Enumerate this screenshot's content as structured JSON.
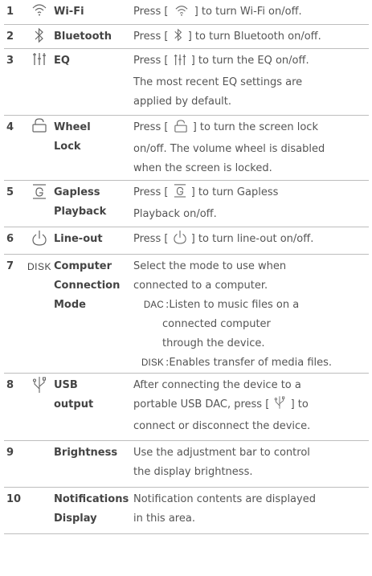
{
  "rows": [
    {
      "num": "1",
      "icon": "wifi-icon",
      "name_lines": [
        "Wi-Fi"
      ],
      "desc_lines": [
        "Press [",
        "] to turn Wi-Fi on/off."
      ]
    },
    {
      "num": "2",
      "icon": "bluetooth-icon",
      "name_lines": [
        "Bluetooth"
      ],
      "desc_lines": [
        "Press [",
        "] to turn Bluetooth on/off."
      ]
    },
    {
      "num": "3",
      "icon": "eq-icon",
      "name_lines": [
        "EQ"
      ],
      "desc_lines": [
        "Press [",
        "] to turn the EQ on/off.",
        "The most recent EQ settings are",
        "applied by default."
      ]
    },
    {
      "num": "4",
      "icon": "lock-icon",
      "name_lines": [
        "Wheel",
        "Lock"
      ],
      "desc_lines": [
        "Press [",
        "] to turn the screen lock",
        "on/off. The volume wheel is disabled",
        "when the screen is locked."
      ]
    },
    {
      "num": "5",
      "icon": "gapless-icon",
      "name_lines": [
        "Gapless",
        "Playback"
      ],
      "desc_lines": [
        "Press [",
        "] to turn Gapless",
        "Playback on/off."
      ]
    },
    {
      "num": "6",
      "icon": "power-icon",
      "name_lines": [
        "Line-out"
      ],
      "desc_lines": [
        "Press [",
        "] to turn line-out on/off."
      ]
    },
    {
      "num": "7",
      "icon_text": "DISK",
      "name_lines": [
        "Computer",
        "Connection",
        "Mode"
      ],
      "desc_lines": [
        "Select the mode to use when",
        "connected to a computer."
      ],
      "modes": [
        {
          "key": "DAC",
          "lines": [
            ":Listen to music files on a",
            "connected computer",
            "through the device."
          ]
        },
        {
          "key": "DISK",
          "lines": [
            ":Enables transfer of media files."
          ]
        }
      ]
    },
    {
      "num": "8",
      "icon": "usb-icon",
      "name_lines": [
        "USB",
        "output"
      ],
      "desc_lines": [
        "After connecting the device to a",
        "portable USB DAC, press [",
        "] to",
        "connect or disconnect the device."
      ]
    },
    {
      "num": "9",
      "name_lines": [
        "Brightness"
      ],
      "desc_lines": [
        "Use the adjustment bar to control",
        "the display brightness."
      ]
    },
    {
      "num": "10",
      "name_lines": [
        "Notifications",
        "Display"
      ],
      "desc_lines": [
        "Notification contents are displayed",
        "in this area."
      ]
    }
  ]
}
